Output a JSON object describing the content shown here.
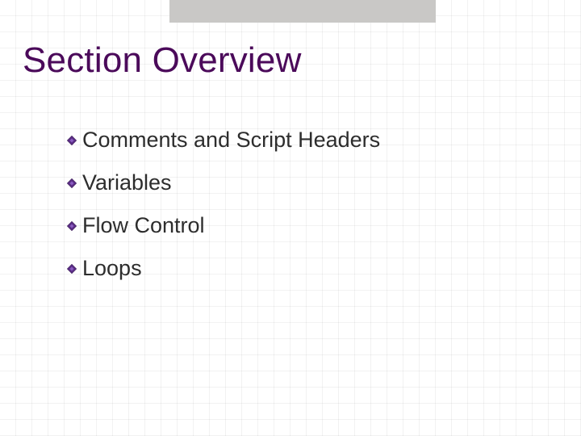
{
  "title": "Section Overview",
  "items": [
    "Comments and Script Headers",
    "Variables",
    "Flow Control",
    "Loops"
  ],
  "colors": {
    "title": "#4b0a5a",
    "bullet": "#5a2c86",
    "text": "#2d2d2d",
    "topbar": "#c9c8c6"
  }
}
